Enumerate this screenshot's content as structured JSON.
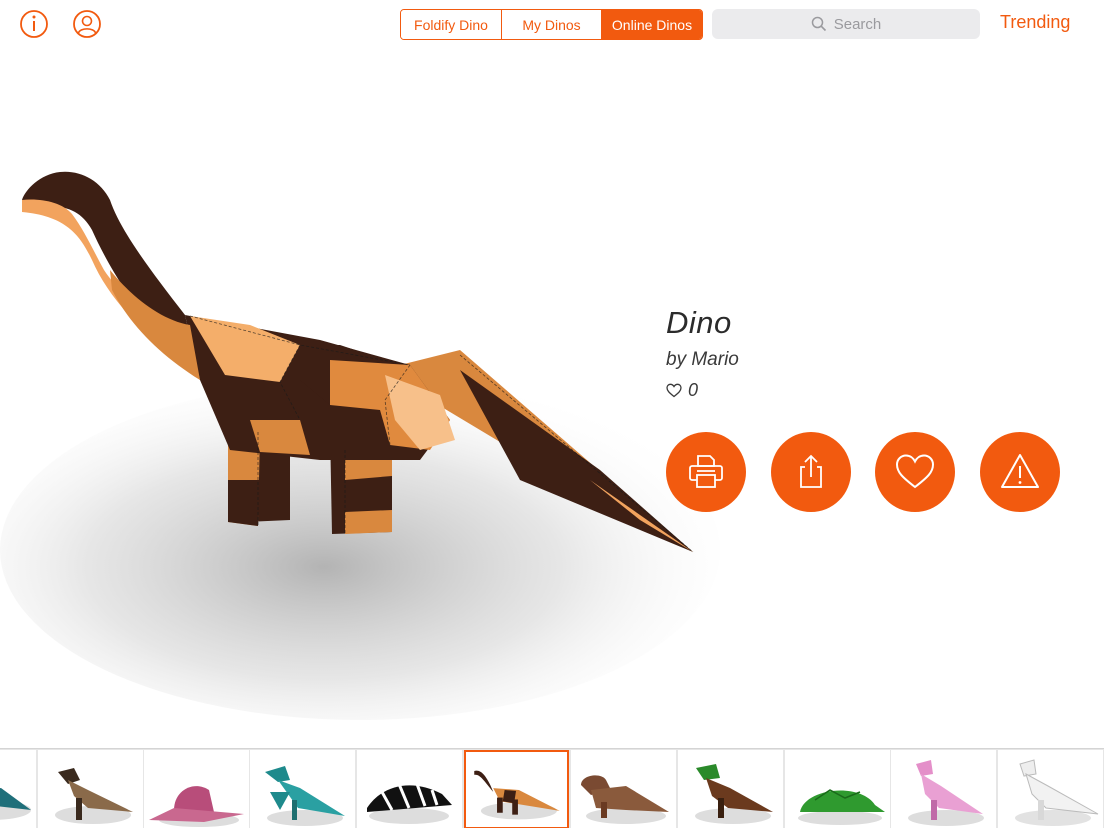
{
  "topbar": {
    "segments": [
      {
        "label": "Foldify Dino",
        "active": false
      },
      {
        "label": "My Dinos",
        "active": false
      },
      {
        "label": "Online Dinos",
        "active": true
      }
    ],
    "search_placeholder": "Search",
    "trending_label": "Trending",
    "icons": {
      "info": "info-icon",
      "profile": "user-profile-icon",
      "search": "magnifier-icon"
    }
  },
  "dino": {
    "title": "Dino",
    "author": "by Mario",
    "likes": "0"
  },
  "actions": [
    "printer-icon",
    "share-icon",
    "heart-icon",
    "warning-icon"
  ],
  "thumbnails": {
    "selected_index": 5,
    "count": 11
  },
  "colors": {
    "accent": "#f25a0f",
    "search_bg": "#ebebed",
    "dino_dark": "#3d1f14",
    "dino_light": "#f2a35e"
  }
}
